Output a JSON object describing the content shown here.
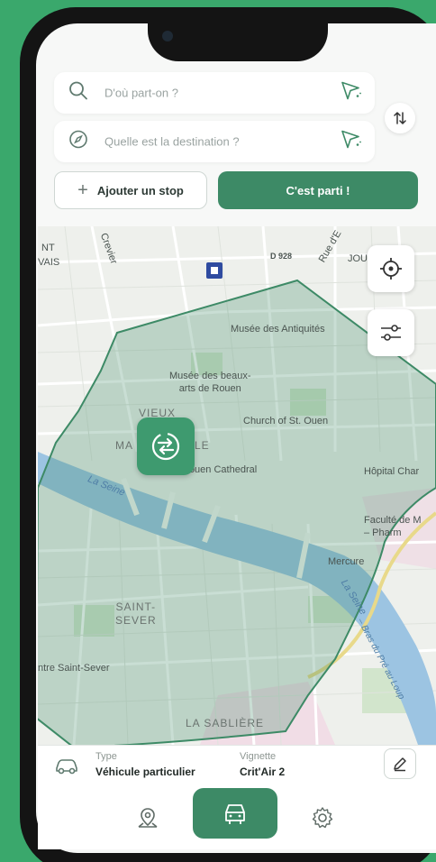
{
  "search": {
    "origin_placeholder": "D'où part-on ?",
    "destination_placeholder": "Quelle est la destination ?"
  },
  "actions": {
    "add_stop_label": "Ajouter un stop",
    "go_label": "C'est parti !"
  },
  "map": {
    "labels": {
      "vieux": "VIEUX",
      "marche": "MA",
      "le": "LE",
      "saint_sever": "SAINT-\nSEVER",
      "la_sabliere": "LA SABLIÈRE",
      "musee_antiquites": "Musée des Antiquités",
      "musee_beaux_arts": "Musée des beaux-\narts de Rouen",
      "church": "Church of St. Ouen",
      "cathedral": "Rouen Cathedral",
      "hopital": "Hôpital Char",
      "faculte": "Faculté de M\n– Pharm",
      "mercure": "Mercure",
      "centre_saint_sever": "ntre Saint-Sever",
      "la_seine": "La Seine",
      "la_seine_2": "La Seine",
      "bras": "– Bras du Pré au Loup",
      "rue_crevier": "Crevier",
      "rue_e": "Rue d'E",
      "jou": "JOU",
      "nt": "NT",
      "vais": "VAIS",
      "d928": "D 928"
    },
    "zone_color": "#3d8a66"
  },
  "vehicle": {
    "type_label": "Type",
    "type_value": "Véhicule particulier",
    "vignette_label": "Vignette",
    "vignette_value": "Crit'Air 2"
  },
  "tabs": [
    {
      "icon": "map-pin-icon",
      "active": false
    },
    {
      "icon": "car-icon",
      "active": true
    },
    {
      "icon": "gear-icon",
      "active": false
    }
  ],
  "colors": {
    "accent": "#3d8a66",
    "background": "#3aa86c"
  }
}
